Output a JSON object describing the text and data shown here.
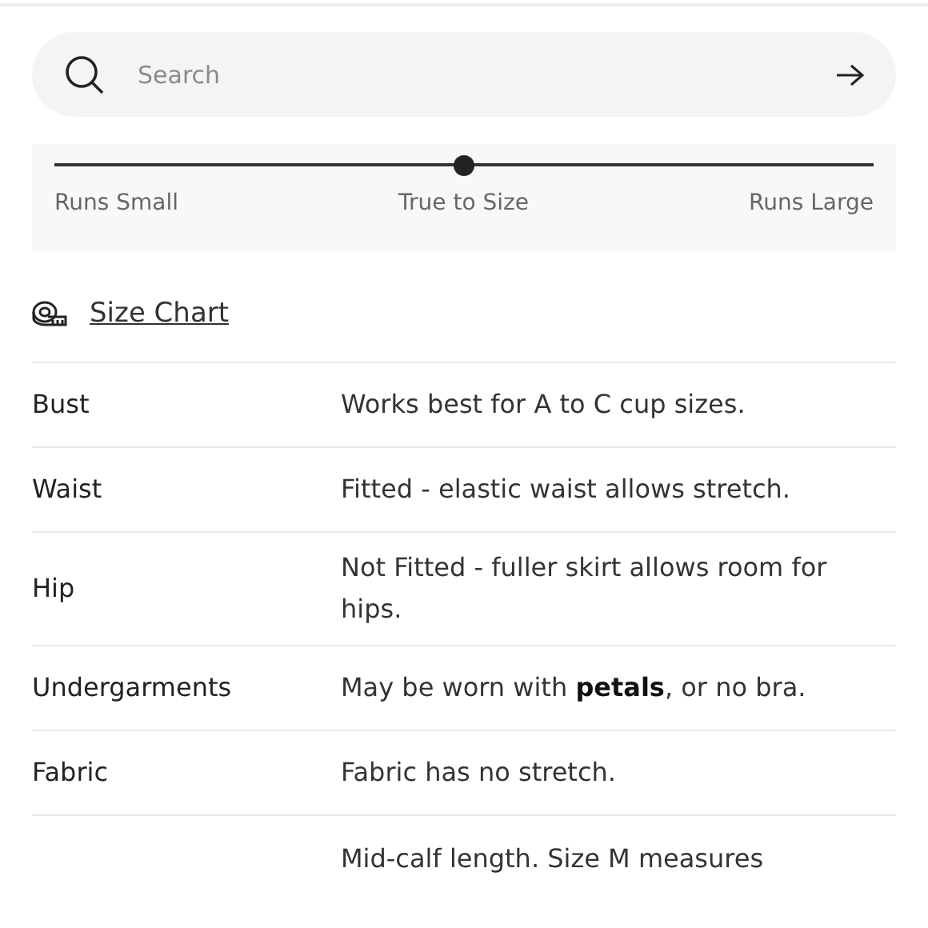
{
  "search": {
    "placeholder": "Search"
  },
  "fit_slider": {
    "level": 0.5,
    "labels": [
      "Runs Small",
      "True to Size",
      "Runs Large"
    ]
  },
  "size_chart_link": "Size Chart",
  "details": [
    {
      "label": "Bust",
      "value": "Works best for A to C cup sizes."
    },
    {
      "label": "Waist",
      "value": "Fitted - elastic waist allows stretch."
    },
    {
      "label": "Hip",
      "value": "Not Fitted - fuller skirt allows room for hips."
    },
    {
      "label": "Undergarments",
      "value": "May be worn with **petals**, or no bra."
    },
    {
      "label": "Fabric",
      "value": "Fabric has no stretch."
    },
    {
      "value": "Mid-calf length. Size M measures"
    }
  ]
}
